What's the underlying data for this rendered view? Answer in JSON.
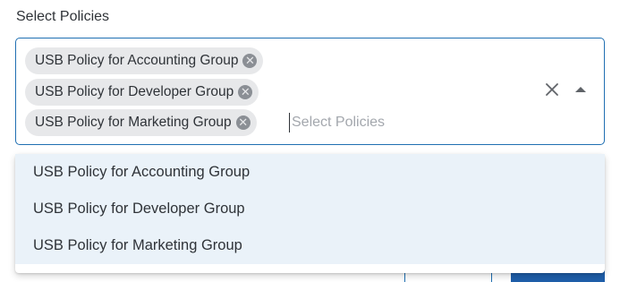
{
  "field": {
    "label": "Select Policies",
    "placeholder": "Select Policies"
  },
  "selected_chips": [
    {
      "label": "USB Policy for Accounting Group"
    },
    {
      "label": "USB Policy for Developer Group"
    },
    {
      "label": "USB Policy for Marketing Group"
    }
  ],
  "chip_remove_glyph": "✕",
  "menu_options": [
    {
      "label": "USB Policy for Accounting Group",
      "selected": true
    },
    {
      "label": "USB Policy for Developer Group",
      "selected": true
    },
    {
      "label": "USB Policy for Marketing Group",
      "selected": true
    }
  ],
  "icons": {
    "clear": "close-icon",
    "toggle": "caret-up-icon",
    "chip_remove": "remove-chip-icon"
  },
  "colors": {
    "accent": "#1f6fb2",
    "chip_bg": "#e7e8ea",
    "option_selected_bg": "#eaf2f9"
  }
}
